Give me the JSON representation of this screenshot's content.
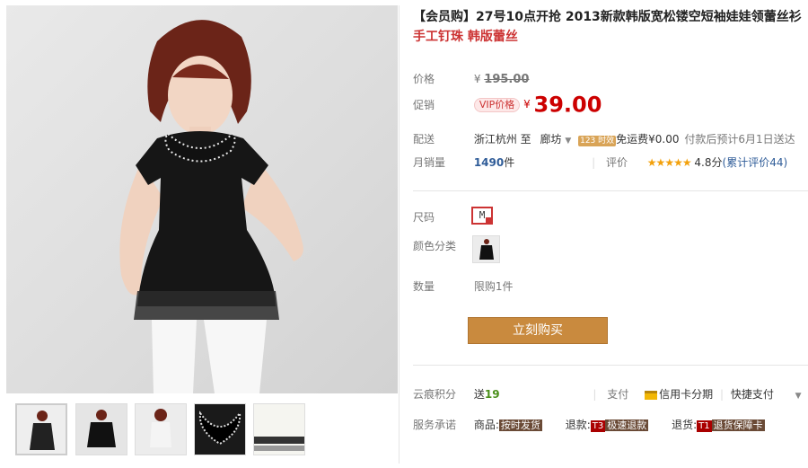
{
  "product": {
    "title": "【会员购】27号10点开抢 2013新款韩版宽松镂空短袖娃娃领蕾丝衫",
    "subtitle": "手工钉珠 韩版蕾丝"
  },
  "price": {
    "label": "价格",
    "currency": "¥",
    "original": "195.00"
  },
  "promo": {
    "label": "促销",
    "vip_badge": "VIP价格",
    "currency": "¥",
    "value": "39.00"
  },
  "shipping": {
    "label": "配送",
    "from": "浙江杭州",
    "to_word": "至",
    "to_city": "廊坊",
    "tag": "123 时效",
    "fee": "免运费¥0.00",
    "note": "付款后预计6月1日送达"
  },
  "sales": {
    "label": "月销量",
    "count": "1490",
    "unit": "件",
    "rating_label": "评价",
    "stars": "★★★★★",
    "score": "4.8分",
    "review_link": "(累计评价44)"
  },
  "options": {
    "size_label": "尺码",
    "size_value": "M",
    "color_label": "颜色分类",
    "qty_label": "数量",
    "qty_limit": "限购1件"
  },
  "buy_button": "立刻购买",
  "bonus": {
    "label": "云痕积分",
    "prefix": "送",
    "points": "19",
    "pay_label": "支付",
    "credit": "信用卡分期",
    "quick": "快捷支付"
  },
  "service": {
    "label": "服务承诺",
    "goods_label": "商品:",
    "goods_tag": "按时发货",
    "refund_label": "退款:",
    "refund_code": "T3",
    "refund_tag": "极速退款",
    "return_label": "退货:",
    "return_code": "T1",
    "return_tag": "退货保障卡"
  },
  "colors": {
    "accent_red": "#cc0000",
    "button": "#c98a3e",
    "link_blue": "#2f5c98"
  }
}
